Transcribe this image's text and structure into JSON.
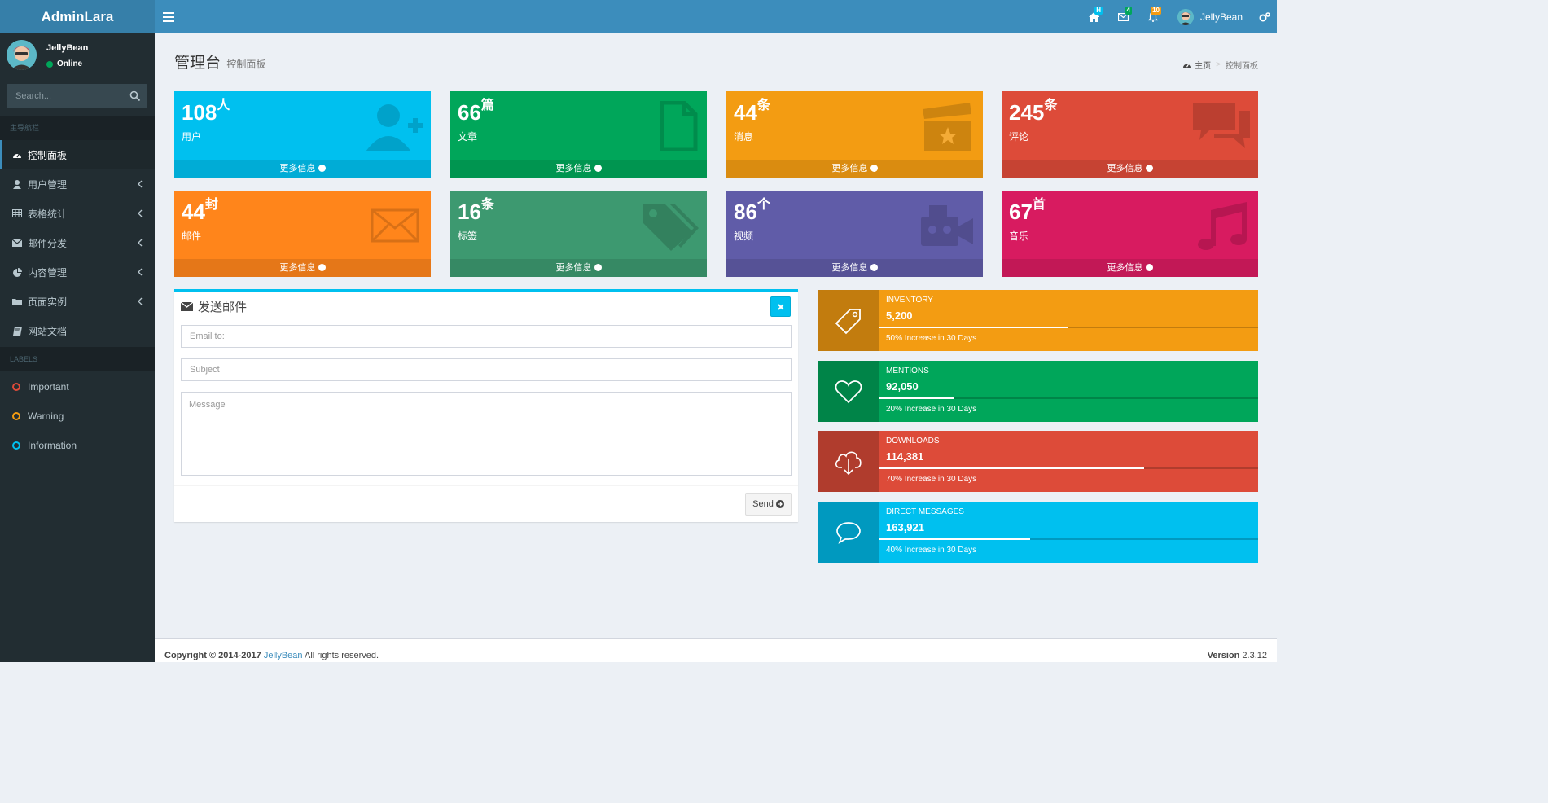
{
  "app": {
    "logo": "AdminLara"
  },
  "navbar": {
    "home_badge": "H",
    "mail_badge": "4",
    "notif_badge": "10",
    "user_name": "JellyBean",
    "colors": {
      "home_badge": "#00c0ef",
      "mail_badge": "#00a65a",
      "notif_badge": "#f39c12"
    }
  },
  "sidebar": {
    "user": {
      "name": "JellyBean",
      "status": "Online"
    },
    "search": {
      "placeholder": "Search..."
    },
    "main_header": "主导航栏",
    "items": [
      {
        "label": "控制面板",
        "icon": "dashboard-icon",
        "active": true
      },
      {
        "label": "用户管理",
        "icon": "user-icon"
      },
      {
        "label": "表格统计",
        "icon": "table-icon"
      },
      {
        "label": "邮件分发",
        "icon": "envelope-icon"
      },
      {
        "label": "内容管理",
        "icon": "pie-chart-icon"
      },
      {
        "label": "页面实例",
        "icon": "folder-icon"
      },
      {
        "label": "网站文档",
        "icon": "book-icon"
      }
    ],
    "labels_header": "LABELS",
    "labels": [
      {
        "label": "Important",
        "color": "#dd4b39"
      },
      {
        "label": "Warning",
        "color": "#f39c12"
      },
      {
        "label": "Information",
        "color": "#00c0ef"
      }
    ]
  },
  "content_header": {
    "title": "管理台",
    "subtitle": "控制面板"
  },
  "breadcrumb": {
    "home": "主页",
    "current": "控制面板"
  },
  "small_boxes": [
    {
      "num": "108",
      "unit": "人",
      "label": "用户",
      "more": "更多信息",
      "color": "#00c0ef",
      "icon": "user-plus-icon"
    },
    {
      "num": "66",
      "unit": "篇",
      "label": "文章",
      "more": "更多信息",
      "color": "#00a65a",
      "icon": "file-icon"
    },
    {
      "num": "44",
      "unit": "条",
      "label": "消息",
      "more": "更多信息",
      "color": "#f39c12",
      "icon": "clapperboard-icon"
    },
    {
      "num": "245",
      "unit": "条",
      "label": "评论",
      "more": "更多信息",
      "color": "#dd4b39",
      "icon": "comments-icon"
    },
    {
      "num": "44",
      "unit": "封",
      "label": "邮件",
      "more": "更多信息",
      "color": "#ff851b",
      "icon": "envelope-icon"
    },
    {
      "num": "16",
      "unit": "条",
      "label": "标签",
      "more": "更多信息",
      "color": "#3d9970",
      "icon": "tags-icon"
    },
    {
      "num": "86",
      "unit": "个",
      "label": "视频",
      "more": "更多信息",
      "color": "#605ca8",
      "icon": "video-camera-icon"
    },
    {
      "num": "67",
      "unit": "首",
      "label": "音乐",
      "more": "更多信息",
      "color": "#d81b60",
      "icon": "music-icon"
    }
  ],
  "mail": {
    "title": "发送邮件",
    "email_placeholder": "Email to:",
    "subject_placeholder": "Subject",
    "message_placeholder": "Message",
    "send_label": "Send"
  },
  "info_boxes": [
    {
      "text": "Inventory",
      "num": "5,200",
      "progress": 50,
      "desc": "50% Increase in 30 Days",
      "color": "#f39c12",
      "icon": "tag-icon"
    },
    {
      "text": "Mentions",
      "num": "92,050",
      "progress": 20,
      "desc": "20% Increase in 30 Days",
      "color": "#00a65a",
      "icon": "heart-icon"
    },
    {
      "text": "Downloads",
      "num": "114,381",
      "progress": 70,
      "desc": "70% Increase in 30 Days",
      "color": "#dd4b39",
      "icon": "cloud-download-icon"
    },
    {
      "text": "Direct Messages",
      "num": "163,921",
      "progress": 40,
      "desc": "40% Increase in 30 Days",
      "color": "#00c0ef",
      "icon": "comment-icon"
    }
  ],
  "footer": {
    "copyright": "Copyright © 2014-2017",
    "author": "JellyBean",
    "rights": "All rights reserved.",
    "version_label": "Version",
    "version": "2.3.12"
  }
}
